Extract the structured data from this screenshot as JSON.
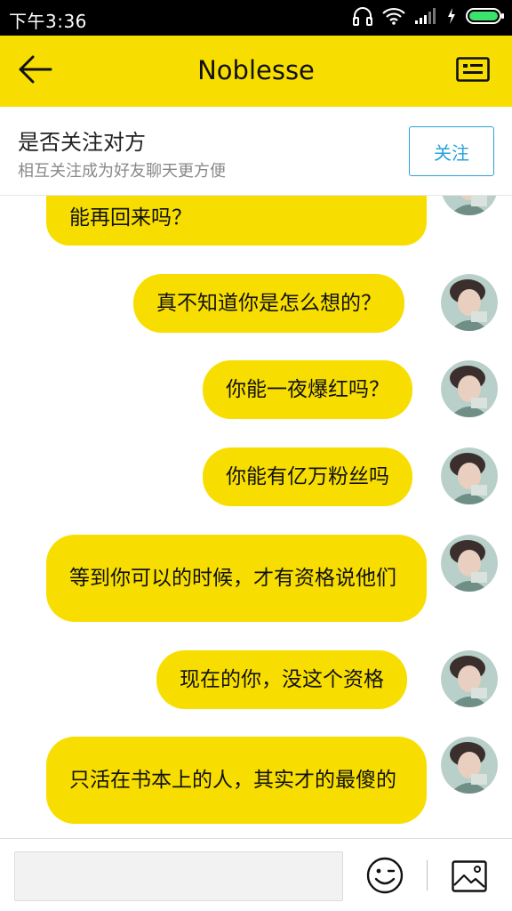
{
  "status_bar": {
    "time": "下午3:36"
  },
  "header": {
    "title": "Noblesse"
  },
  "follow_prompt": {
    "question": "是否关注对方",
    "hint": "相互关注成为好友聊天更方便",
    "button_label": "关注"
  },
  "messages": [
    {
      "text": "能再回来吗？"
    },
    {
      "text": "真不知道你是怎么想的？"
    },
    {
      "text": "你能一夜爆红吗？"
    },
    {
      "text": "你能有亿万粉丝吗"
    },
    {
      "text": "等到你可以的时候，才有资格说他们"
    },
    {
      "text": "现在的你，没这个资格"
    },
    {
      "text": "只活在书本上的人，其实才的最傻的"
    }
  ],
  "composer": {
    "placeholder": ""
  },
  "colors": {
    "accent": "#f8de00",
    "follow_button": "#29a3d9",
    "status_bar": "#000000"
  },
  "icons": [
    "headphone-icon",
    "wifi-icon",
    "signal-icon",
    "charging-icon",
    "battery-icon",
    "back-arrow-icon",
    "profile-card-icon",
    "emoji-icon",
    "image-icon"
  ]
}
